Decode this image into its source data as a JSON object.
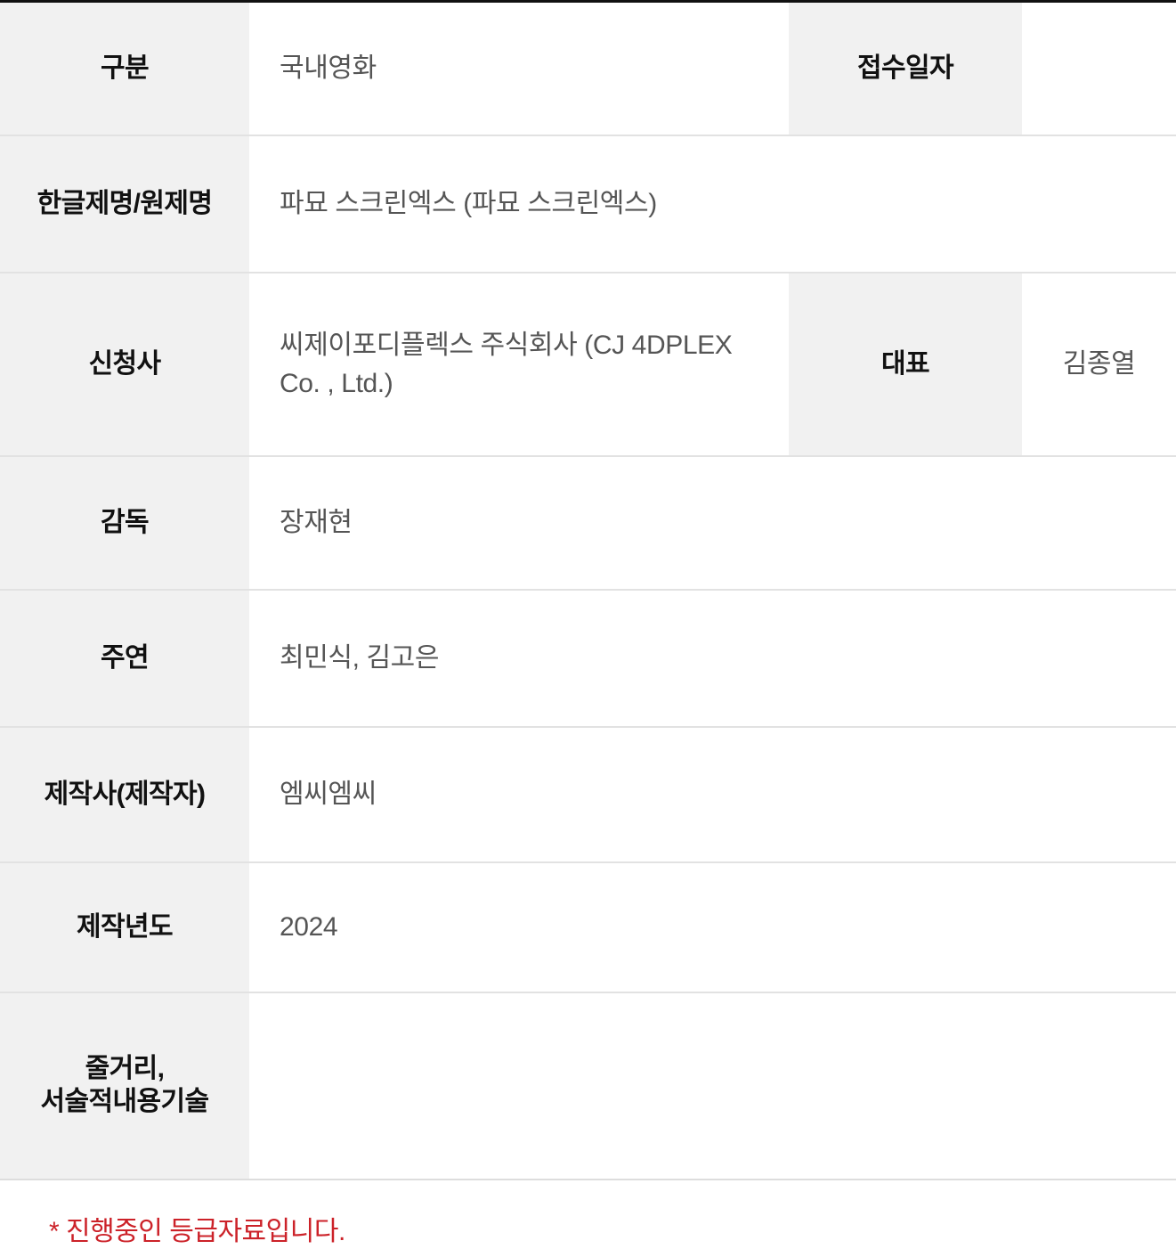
{
  "table": {
    "rows": [
      {
        "label": "구분",
        "value": "국내영화",
        "label2": "접수일자",
        "value2": ""
      },
      {
        "label": "한글제명/원제명",
        "value": "파묘 스크린엑스  (파묘 스크린엑스)",
        "label2": "",
        "value2": ""
      },
      {
        "label": "신청사",
        "value": "씨제이포디플렉스 주식회사 (CJ 4DPLEX Co. , Ltd.)",
        "label2": "대표",
        "value2": "김종열"
      },
      {
        "label": "감독",
        "value": "장재현",
        "label2": "",
        "value2": ""
      },
      {
        "label": "주연",
        "value": "최민식, 김고은",
        "label2": "",
        "value2": ""
      },
      {
        "label": "제작사(제작자)",
        "value": "엠씨엠씨",
        "label2": "",
        "value2": ""
      },
      {
        "label": "제작년도",
        "value": "2024",
        "label2": "",
        "value2": ""
      },
      {
        "label_line1": "줄거리,",
        "label_line2": "서술적내용기술",
        "value": "",
        "label2": "",
        "value2": ""
      }
    ]
  },
  "footnote": {
    "text": "* 진행중인 등급자료입니다.",
    "color": "#cc2229"
  },
  "colors": {
    "label_background": "#f1f1f1",
    "label_text": "#111111",
    "value_text": "#555555",
    "row_border": "#e2e2e2",
    "top_border": "#111111",
    "page_background": "#ffffff"
  }
}
